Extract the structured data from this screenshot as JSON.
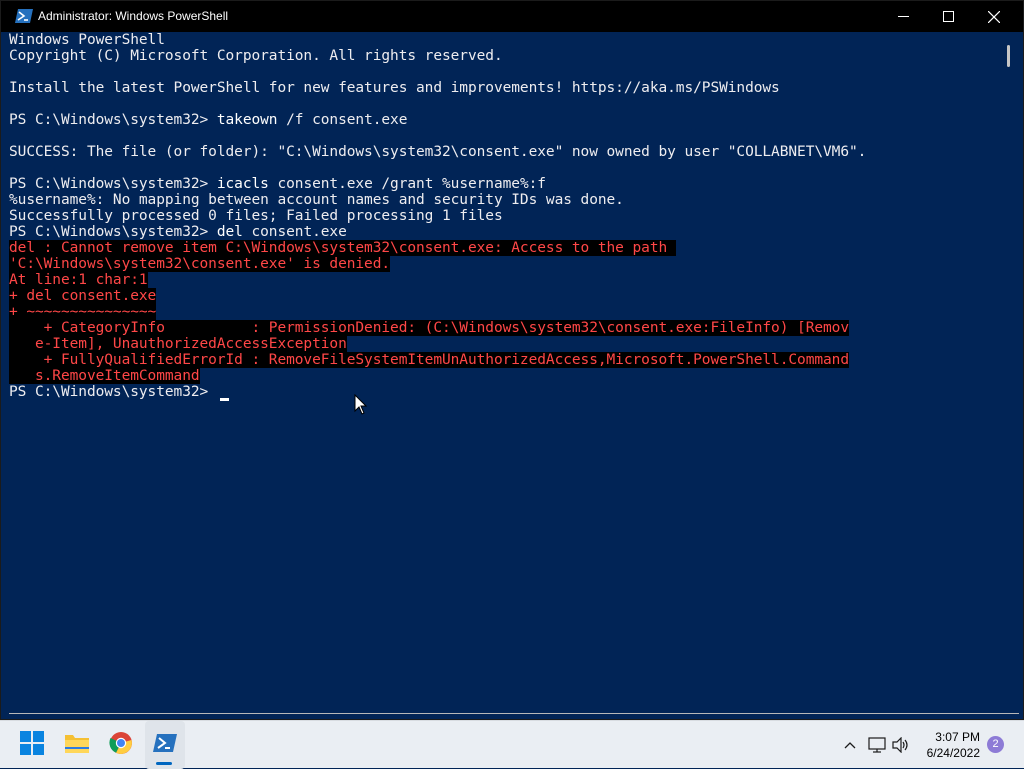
{
  "window": {
    "title": "Administrator: Windows PowerShell",
    "icons": {
      "app": "powershell-icon",
      "minimize": "minimize-icon",
      "maximize": "maximize-icon",
      "close": "close-icon"
    }
  },
  "console": {
    "lines": [
      {
        "text": "Windows PowerShell",
        "type": "normal"
      },
      {
        "text": "Copyright (C) Microsoft Corporation. All rights reserved.",
        "type": "normal"
      },
      {
        "text": "",
        "type": "normal"
      },
      {
        "text": "Install the latest PowerShell for new features and improvements! https://aka.ms/PSWindows",
        "type": "normal"
      },
      {
        "text": "",
        "type": "normal"
      },
      {
        "prompt": "PS C:\\Windows\\system32> ",
        "cmd": "takeown",
        "args": " /f consent.exe",
        "type": "prompt"
      },
      {
        "text": "",
        "type": "normal"
      },
      {
        "text": "SUCCESS: The file (or folder): \"C:\\Windows\\system32\\consent.exe\" now owned by user \"COLLABNET\\VM6\".",
        "type": "normal"
      },
      {
        "text": "",
        "type": "normal"
      },
      {
        "prompt": "PS C:\\Windows\\system32> ",
        "cmd": "icacls",
        "args": " consent.exe /grant %username%:f",
        "type": "prompt"
      },
      {
        "text": "%username%: No mapping between account names and security IDs was done.",
        "type": "normal"
      },
      {
        "text": "Successfully processed 0 files; Failed processing 1 files",
        "type": "normal"
      },
      {
        "prompt": "PS C:\\Windows\\system32> ",
        "cmd": "del",
        "args": " consent.exe",
        "type": "prompt"
      },
      {
        "text": "del : Cannot remove item C:\\Windows\\system32\\consent.exe: Access to the path ",
        "type": "error"
      },
      {
        "text": "'C:\\Windows\\system32\\consent.exe' is denied.",
        "type": "error"
      },
      {
        "text": "At line:1 char:1",
        "type": "error"
      },
      {
        "text": "+ del consent.exe",
        "type": "error"
      },
      {
        "text": "+ ~~~~~~~~~~~~~~~",
        "type": "error"
      },
      {
        "text": "    + CategoryInfo          : PermissionDenied: (C:\\Windows\\system32\\consent.exe:FileInfo) [Remov",
        "type": "error"
      },
      {
        "text": "   e-Item], UnauthorizedAccessException",
        "type": "error"
      },
      {
        "text": "    + FullyQualifiedErrorId : RemoveFileSystemItemUnAuthorizedAccess,Microsoft.PowerShell.Command",
        "type": "error"
      },
      {
        "text": "   s.RemoveItemCommand",
        "type": "error"
      },
      {
        "prompt": "PS C:\\Windows\\system32> ",
        "cmd": "",
        "args": "",
        "type": "prompt"
      }
    ]
  },
  "taskbar": {
    "apps": [
      {
        "name": "start-button",
        "icon": "windows-logo-icon"
      },
      {
        "name": "file-explorer-button",
        "icon": "folder-icon"
      },
      {
        "name": "chrome-button",
        "icon": "chrome-icon"
      },
      {
        "name": "powershell-taskbar-button",
        "icon": "powershell-icon"
      }
    ],
    "tray": {
      "icons": [
        "chevron-up-icon",
        "network-icon",
        "volume-icon"
      ],
      "time": "3:07 PM",
      "date": "6/24/2022",
      "notification_count": "2"
    }
  },
  "colors": {
    "console_bg": "#012456",
    "console_text": "#eeedf0",
    "error_text": "#ff4747",
    "error_bg": "#000000",
    "titlebar_bg": "#000000",
    "taskbar_bg": "#eaeef3"
  }
}
